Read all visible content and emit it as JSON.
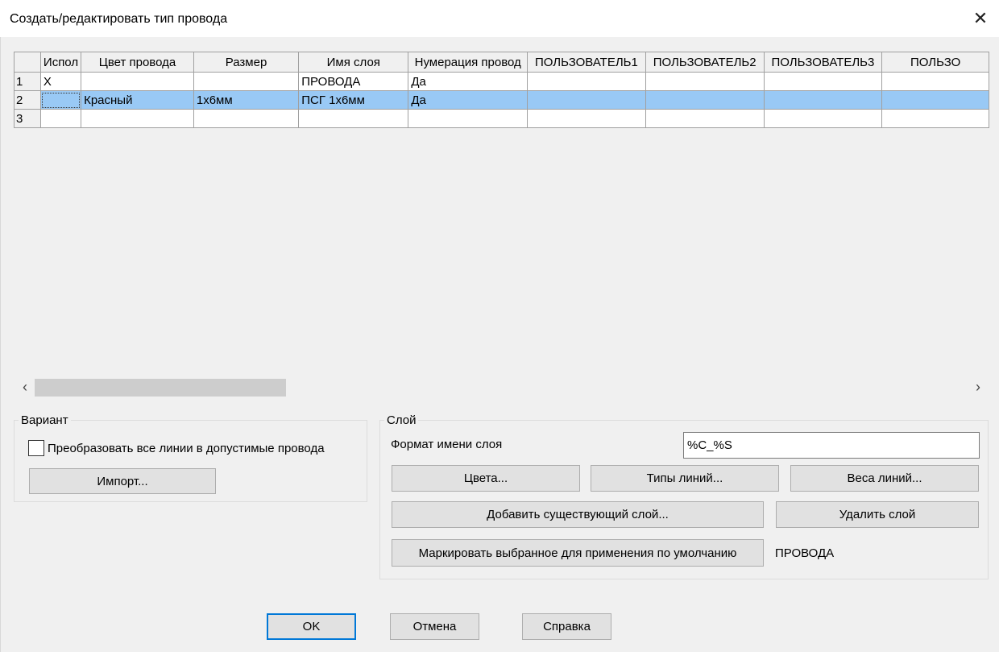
{
  "window": {
    "title": "Создать/редактировать тип провода",
    "close_icon": "close-icon"
  },
  "grid": {
    "columns": [
      "",
      "Испол",
      "Цвет провода",
      "Размер",
      "Имя слоя",
      "Нумерация провод",
      "ПОЛЬЗОВАТЕЛЬ1",
      "ПОЛЬЗОВАТЕЛЬ2",
      "ПОЛЬЗОВАТЕЛЬ3",
      "ПОЛЬЗО"
    ],
    "rows": [
      [
        "1",
        "X",
        "",
        "",
        "ПРОВОДА",
        "Да",
        "",
        "",
        "",
        ""
      ],
      [
        "2",
        "",
        "Красный",
        "1x6мм",
        "ПСГ 1x6мм",
        "Да",
        "",
        "",
        "",
        ""
      ],
      [
        "3",
        "",
        "",
        "",
        "",
        "",
        "",
        "",
        "",
        ""
      ]
    ],
    "selected_row": 2,
    "selection_color": "#99c9f5"
  },
  "scrollbar": {
    "left_icon": "chevron-left-icon",
    "right_icon": "chevron-right-icon"
  },
  "variant": {
    "group_label": "Вариант",
    "convert_checkbox_label": "Преобразовать все линии в допустимые провода",
    "convert_checked": false,
    "import_button": "Импорт..."
  },
  "layer": {
    "group_label": "Слой",
    "format_label": "Формат имени слоя",
    "format_value": "%C_%S",
    "colors_button": "Цвета...",
    "linetypes_button": "Типы линий...",
    "lineweights_button": "Веса линий...",
    "add_existing_button": "Добавить существующий слой...",
    "delete_button": "Удалить слой",
    "mark_default_button": "Маркировать выбранное для применения по умолчанию",
    "default_layer": "ПРОВОДА"
  },
  "footer": {
    "ok_button": "OK",
    "cancel_button": "Отмена",
    "help_button": "Справка"
  }
}
